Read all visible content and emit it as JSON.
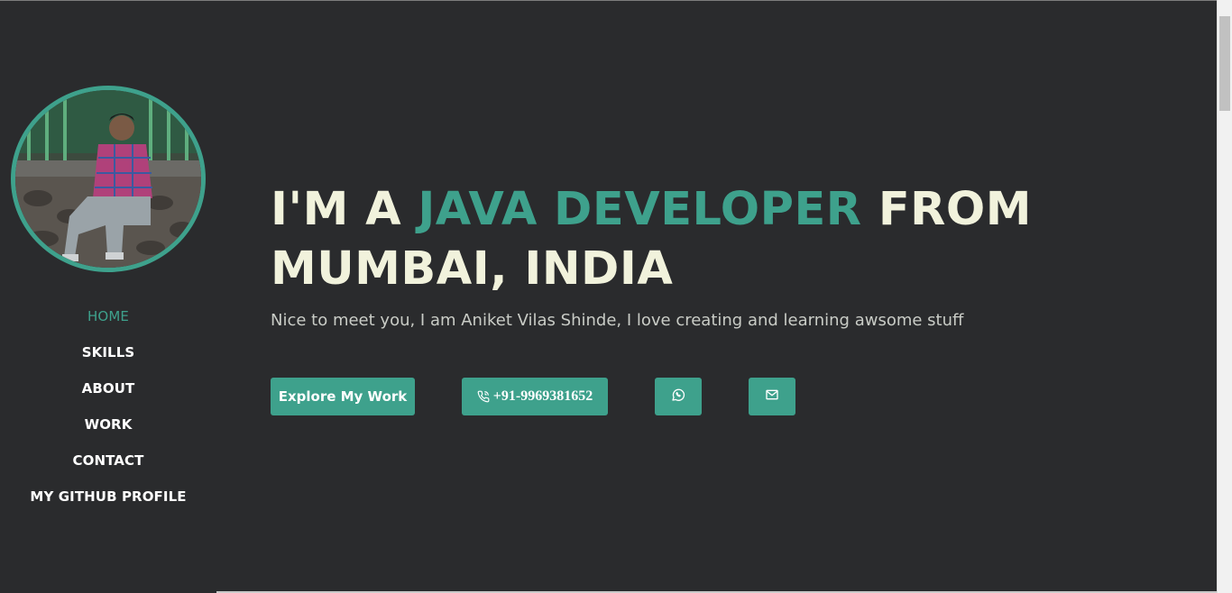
{
  "sidebar": {
    "nav": [
      {
        "label": "HOME",
        "active": true
      },
      {
        "label": "SKILLS"
      },
      {
        "label": "ABOUT"
      },
      {
        "label": "WORK"
      },
      {
        "label": "CONTACT"
      },
      {
        "label": "MY GITHUB PROFILE"
      }
    ]
  },
  "hero": {
    "headline_pre": "I'M A ",
    "headline_accent": "JAVA DEVELOPER",
    "headline_post": " FROM MUMBAI, INDIA",
    "intro": "Nice to meet you, I am Aniket Vilas Shinde, I love creating and learning awsome stuff"
  },
  "buttons": {
    "explore": "Explore My Work",
    "phone": "+91-9969381652",
    "whatsapp_icon": "whatsapp-icon",
    "mail_icon": "mail-icon"
  },
  "colors": {
    "accent": "#3ea18c",
    "background": "#2a2b2d",
    "headline": "#f1f2dc"
  }
}
